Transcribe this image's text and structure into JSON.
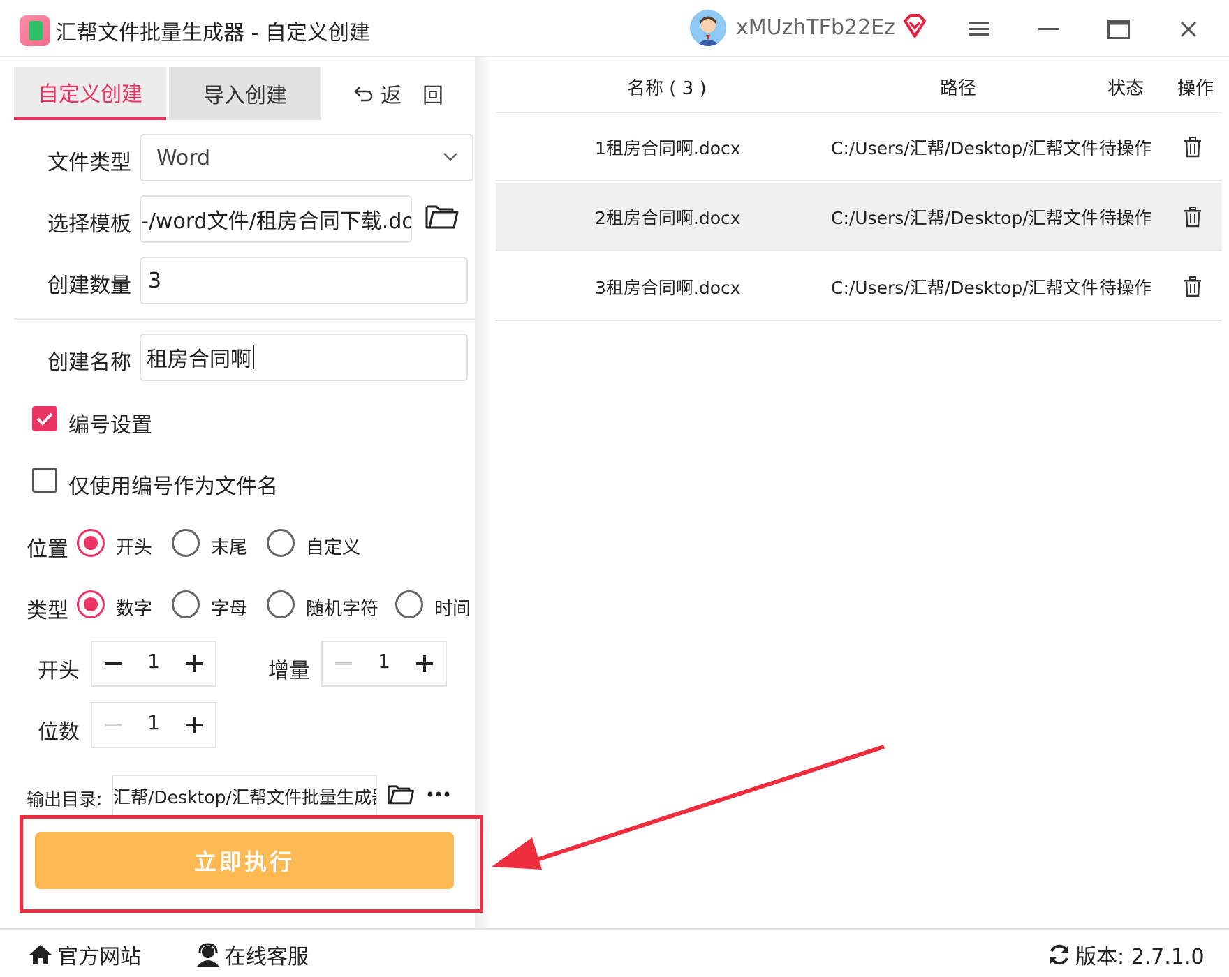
{
  "titlebar": {
    "title": "汇帮文件批量生成器 - 自定义创建",
    "username": "xMUzhTFb22Ez"
  },
  "tabs": [
    {
      "label": "自定义创建",
      "active": true
    },
    {
      "label": "导入创建",
      "active": false
    },
    {
      "label": "返　回",
      "active": false
    }
  ],
  "form": {
    "file_type_label": "文件类型",
    "file_type_value": "Word",
    "template_label": "选择模板",
    "template_value": "-/word文件/租房合同下载.doc",
    "count_label": "创建数量",
    "count_value": "3",
    "name_label": "创建名称",
    "name_value": "租房合同啊",
    "numbering_label": "编号设置",
    "numbering_checked": true,
    "only_number_label": "仅使用编号作为文件名",
    "only_number_checked": false,
    "position_label": "位置",
    "position_options": [
      "开头",
      "末尾",
      "自定义"
    ],
    "type_label": "类型",
    "type_options": [
      "数字",
      "字母",
      "随机字符",
      "时间"
    ],
    "start_label": "开头",
    "start_value": "1",
    "increment_label": "增量",
    "increment_value": "1",
    "digits_label": "位数",
    "digits_value": "1",
    "output_label": "输出目录:",
    "output_value": "汇帮/Desktop/汇帮文件批量生成器",
    "run_label": "立即执行"
  },
  "table": {
    "headers": [
      "名称 ( 3 )",
      "路径",
      "状态",
      "操作"
    ],
    "rows": [
      {
        "name": "1租房合同啊.docx",
        "path": "C:/Users/汇帮/Desktop/汇帮文件",
        "status": "待操作"
      },
      {
        "name": "2租房合同啊.docx",
        "path": "C:/Users/汇帮/Desktop/汇帮文件",
        "status": "待操作"
      },
      {
        "name": "3租房合同啊.docx",
        "path": "C:/Users/汇帮/Desktop/汇帮文件",
        "status": "待操作"
      }
    ]
  },
  "statusbar": {
    "website": "官方网站",
    "support": "在线客服",
    "version": "版本:  2.7.1.0"
  },
  "colors": {
    "accent": "#ea3463",
    "run_button": "#fdb952",
    "highlight_border": "#ee2d3f"
  }
}
